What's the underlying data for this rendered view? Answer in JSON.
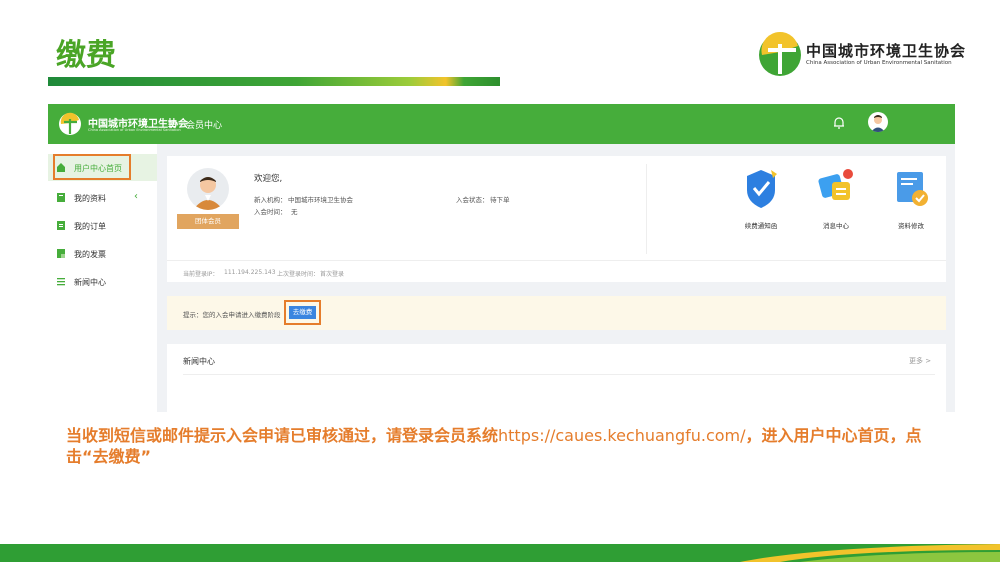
{
  "slide": {
    "title": "缴费",
    "caption_prefix": "当收到短信或邮件提示入会申请已审核通过，请登录会员系统",
    "caption_url": "https://caues.kechuangfu.com/",
    "caption_suffix": "，进入用户中心首页，点击“去缴费”"
  },
  "logo": {
    "cn": "中国城市环境卫生协会",
    "en": "China Association of Urban Environmental Sanitation"
  },
  "app": {
    "logo_cn": "中国城市环境卫生协会",
    "logo_en": "China Association of Urban Environmental Sanitation",
    "menu_label": "会员中心"
  },
  "sidebar": {
    "items": [
      {
        "label": "用户中心首页",
        "icon": "home-icon"
      },
      {
        "label": "我的资料",
        "icon": "profile-icon"
      },
      {
        "label": "我的订单",
        "icon": "order-icon"
      },
      {
        "label": "我的发票",
        "icon": "invoice-icon"
      },
      {
        "label": "新闻中心",
        "icon": "list-icon"
      }
    ]
  },
  "user_card": {
    "group_label": "团体会员",
    "welcome": "欢迎您,",
    "org_label": "新入机构：",
    "org_value": "中国城市环境卫生协会",
    "join_time_label": "入会时间：",
    "join_time_value": "无",
    "status_label": "入会状态：",
    "status_value": "待下单",
    "login_ip_label": "当前登录IP：",
    "login_ip_value": "111.194.225.143",
    "last_login_label": "上次登录时间：",
    "last_login_value": "首次登录"
  },
  "quick_links": [
    {
      "label": "续费通知函",
      "icon": "shield-check-icon"
    },
    {
      "label": "消息中心",
      "icon": "message-icon"
    },
    {
      "label": "资料修改",
      "icon": "edit-profile-icon"
    }
  ],
  "tip": {
    "text": "提示：您的入会申请进入缴费阶段",
    "button": "去缴费"
  },
  "news": {
    "title": "新闻中心",
    "more": "更多 >"
  },
  "colors": {
    "brand_green": "#46ad3b",
    "title_green": "#4aa526",
    "highlight_orange": "#e57d2c",
    "button_blue": "#3a85e0"
  }
}
